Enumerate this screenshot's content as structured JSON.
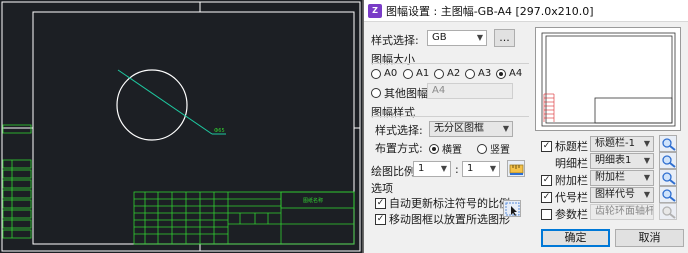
{
  "cad": {
    "dimension_text": "Ф65",
    "sheet_label": "图纸名称",
    "colors": {
      "background": "#1c1f24",
      "lines": "#ffffff",
      "text": "#31d231",
      "table": "#31d231",
      "axis": "#1ec8a0"
    }
  },
  "dialog": {
    "title": "图幅设置 : 主图幅-GB-A4 [297.0x210.0]",
    "icon": "app-logo-icon",
    "style_label": "样式选择:",
    "style_value": "GB",
    "browse_label": "...",
    "paper_size": {
      "section": "图幅大小",
      "options": [
        "A0",
        "A1",
        "A2",
        "A3",
        "A4"
      ],
      "selected": "A4",
      "other_label": "其他图幅",
      "other_value": "A4"
    },
    "frame_style": {
      "section": "图幅样式",
      "style_label": "样式选择:",
      "style_value": "无分区图框",
      "layout_label": "布置方式:",
      "layout_options": [
        "横置",
        "竖置"
      ],
      "layout_selected": "横置"
    },
    "scale": {
      "label": "绘图比例:",
      "left": "1",
      "sep": ":",
      "right": "1"
    },
    "options": {
      "section": "选项",
      "items": [
        {
          "label": "自动更新标注符号的比例",
          "checked": true
        },
        {
          "label": "移动图框以放置所选图形",
          "checked": true
        }
      ]
    },
    "right_fields": [
      {
        "label": "标题栏",
        "value": "标题栏-1",
        "checked": true,
        "has_checkbox": true,
        "enabled": true
      },
      {
        "label": "明细栏",
        "value": "明细表1",
        "checked": false,
        "has_checkbox": false,
        "enabled": true
      },
      {
        "label": "附加栏",
        "value": "附加栏",
        "checked": true,
        "has_checkbox": true,
        "enabled": true
      },
      {
        "label": "代号栏",
        "value": "图样代号",
        "checked": true,
        "has_checkbox": true,
        "enabled": true
      },
      {
        "label": "参数栏",
        "value": "齿轮环面轴杆",
        "checked": false,
        "has_checkbox": true,
        "enabled": false
      }
    ],
    "ok_label": "确定",
    "cancel_label": "取消",
    "accent": "#0078d7"
  }
}
